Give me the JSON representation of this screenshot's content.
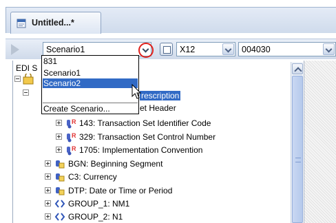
{
  "tab": {
    "title": "Untitled...*"
  },
  "toolbar": {
    "scenario_value": "Scenario1",
    "standard_value": "X12",
    "version_value": "004030"
  },
  "dropdown": {
    "options": [
      "831",
      "Scenario1",
      "Scenario2"
    ],
    "selected_index": 2,
    "action": "Create Scenario..."
  },
  "tree": {
    "root_label": "EDI S",
    "hidden_rows": {
      "row1_suffix": "rescription",
      "row2_suffix": "et Header"
    },
    "rows": [
      {
        "label": "143: Transaction Set Identifier Code",
        "icon": "element-icon"
      },
      {
        "label": "329: Transaction Set Control Number",
        "icon": "element-icon"
      },
      {
        "label": "1705: Implementation Convention",
        "icon": "element-icon"
      },
      {
        "label": "BGN: Beginning Segment",
        "icon": "segment-icon"
      },
      {
        "label": "C3: Currency",
        "icon": "segment-icon"
      },
      {
        "label": "DTP: Date or Time or Period",
        "icon": "segment-icon"
      },
      {
        "label": "GROUP_1: NM1",
        "icon": "group-icon"
      },
      {
        "label": "GROUP_2: N1",
        "icon": "group-icon"
      }
    ]
  },
  "colors": {
    "selection": "#316ac5",
    "highlight_ring": "#e0201b"
  }
}
